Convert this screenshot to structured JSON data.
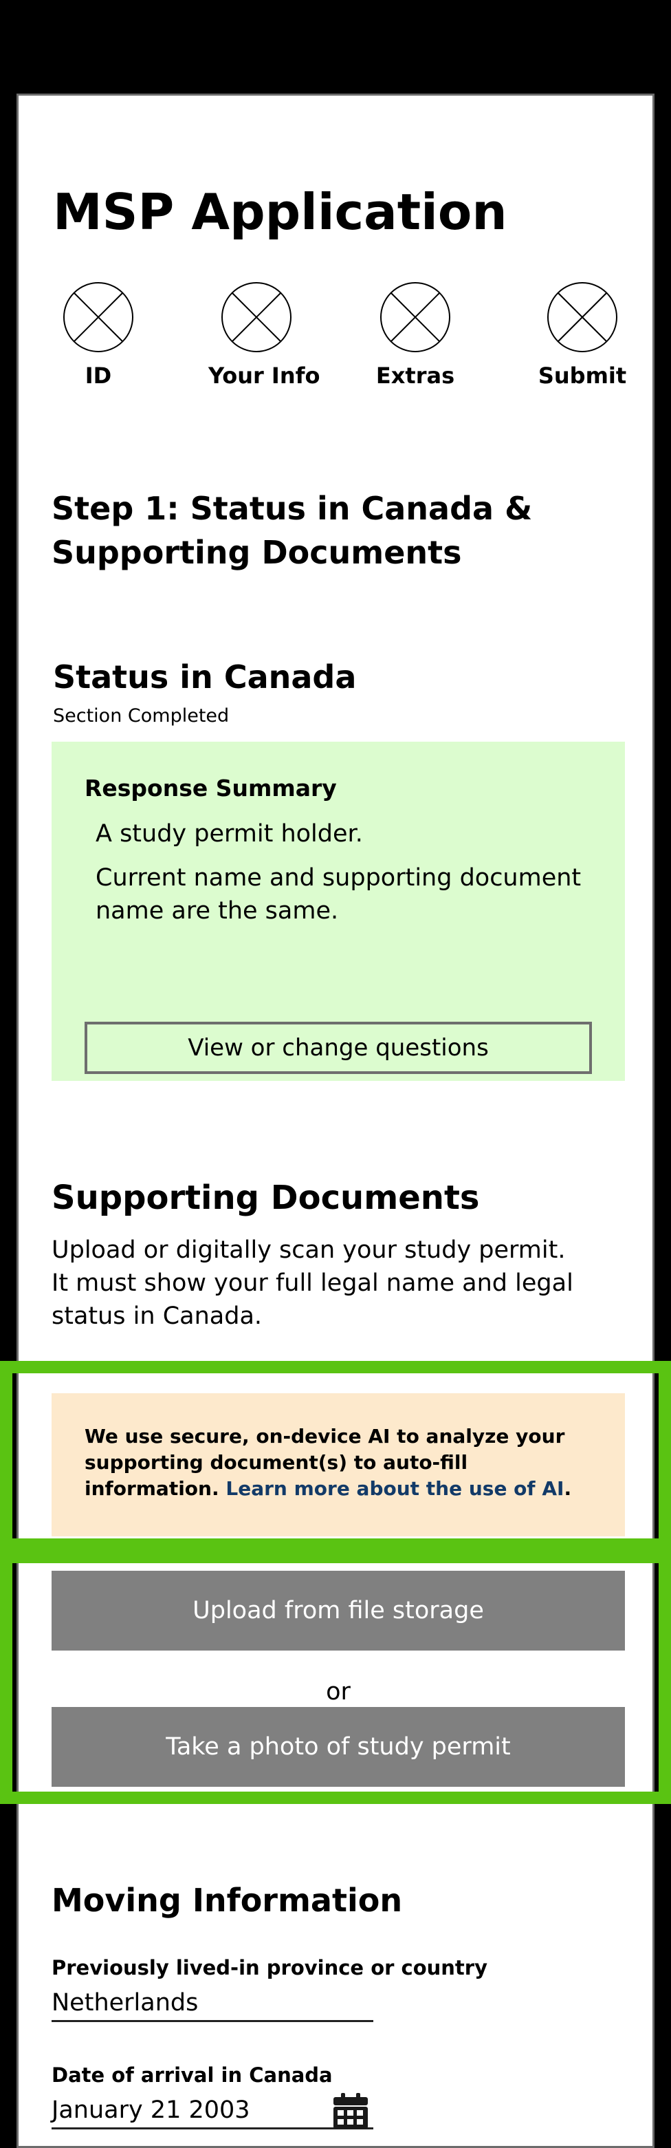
{
  "app": {
    "title": "MSP Application"
  },
  "progress_steps": [
    {
      "label": "ID"
    },
    {
      "label": "Your Info"
    },
    {
      "label": "Extras"
    },
    {
      "label": "Submit"
    }
  ],
  "step_heading": "Step 1: Status in Canada & Supporting Documents",
  "status_section": {
    "title": "Status in Canada",
    "subtitle": "Section Completed",
    "summary": {
      "title": "Response Summary",
      "items": [
        "A study permit holder.",
        "Current name and supporting document name are the same."
      ],
      "button_label": "View or change questions"
    }
  },
  "supporting_documents": {
    "title": "Supporting Documents",
    "description": "Upload or digitally scan your study permit. It must show your full legal name and legal status in Canada.",
    "ai_notice": {
      "text": "We use secure, on-device AI to analyze your supporting document(s) to auto-fill information.",
      "link_text": "Learn more about the use of AI",
      "period": "."
    },
    "upload_button_label": "Upload from file storage",
    "or_label": "or",
    "photo_button_label": "Take a photo of study permit"
  },
  "moving_information": {
    "title": "Moving Information",
    "fields": [
      {
        "label": "Previously lived-in province or country",
        "value": "Netherlands"
      },
      {
        "label": "Date of arrival in Canada",
        "value": "January 21 2003"
      }
    ]
  },
  "colors": {
    "highlight": "#5ac312",
    "summary_background": "#dcfccf",
    "ai_notice_background": "#fde9cc",
    "button_grey": "#808080",
    "link": "#123a68"
  }
}
